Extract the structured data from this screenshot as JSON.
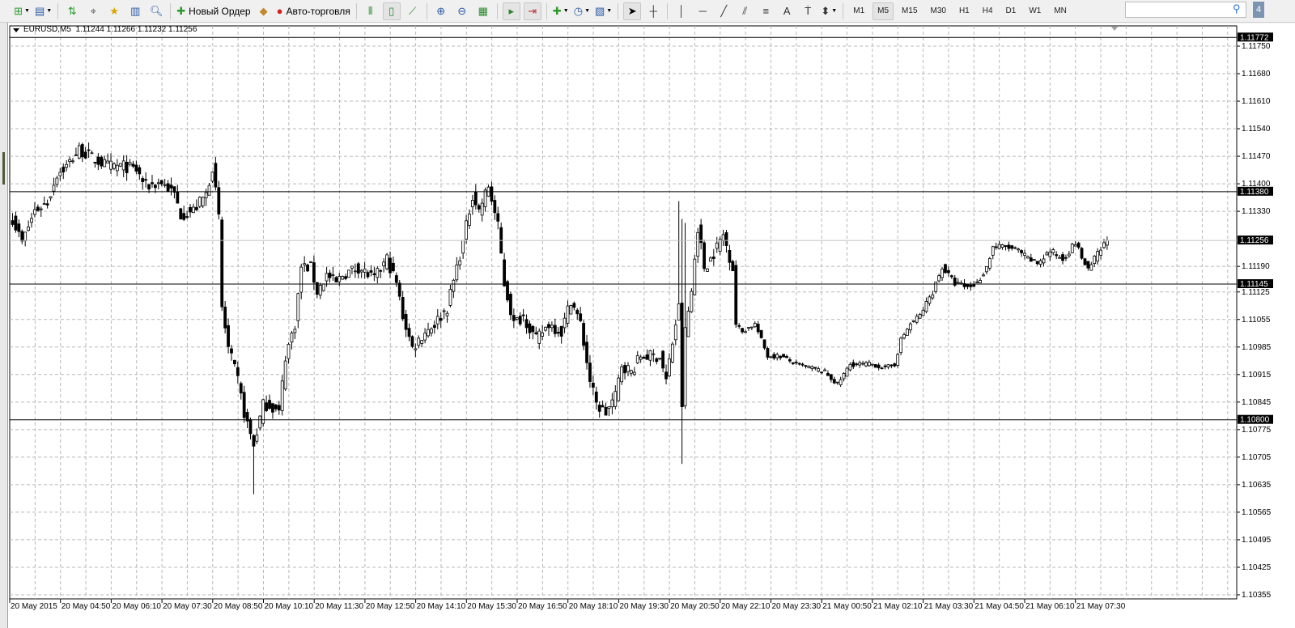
{
  "toolbar": {
    "new_order": "Новый Ордер",
    "auto_trading": "Авто-торговля",
    "timeframes": [
      "M1",
      "M5",
      "M15",
      "M30",
      "H1",
      "H4",
      "D1",
      "W1",
      "MN"
    ],
    "active_timeframe": "M5",
    "search_placeholder": "",
    "badge": "4",
    "icons": [
      "new-chart-icon",
      "profiles-icon",
      "market-watch-icon",
      "navigator-icon",
      "data-window-icon",
      "terminal-icon",
      "strategy-tester-icon",
      "new-order-icon",
      "metaeditor-icon",
      "auto-trading-icon",
      "bar-chart-icon",
      "candlesticks-icon",
      "line-chart-icon",
      "zoom-in-icon",
      "zoom-out-icon",
      "tile-windows-icon",
      "chart-shift-icon",
      "autoscroll-icon",
      "indicators-icon",
      "periods-icon",
      "templates-icon",
      "cursor-icon",
      "crosshair-icon",
      "vertical-line-icon",
      "horizontal-line-icon",
      "trendline-icon",
      "fibonacci-icon",
      "channel-icon",
      "text-icon",
      "text-label-icon",
      "arrows-icon"
    ]
  },
  "chart": {
    "symbol_info": "EURUSD,M5  1.11244 1.11266 1.11232 1.11256",
    "price_labels": [
      "1.11750",
      "1.11680",
      "1.11610",
      "1.11540",
      "1.11470",
      "1.11400",
      "1.11330",
      "1.11190",
      "1.11125",
      "1.11055",
      "1.10985",
      "1.10915",
      "1.10845",
      "1.10775",
      "1.10705",
      "1.10635",
      "1.10565",
      "1.10495",
      "1.10425",
      "1.10355"
    ],
    "time_labels": [
      "20 May 2015",
      "20 May 04:50",
      "20 May 06:10",
      "20 May 07:30",
      "20 May 08:50",
      "20 May 10:10",
      "20 May 11:30",
      "20 May 12:50",
      "20 May 14:10",
      "20 May 15:30",
      "20 May 16:50",
      "20 May 18:10",
      "20 May 19:30",
      "20 May 20:50",
      "20 May 22:10",
      "20 May 23:30",
      "21 May 00:50",
      "21 May 02:10",
      "21 May 03:30",
      "21 May 04:50",
      "21 May 06:10",
      "21 May 07:30"
    ],
    "hlines": [
      "1.11772",
      "1.11380",
      "1.11145",
      "1.10800"
    ],
    "bid": "1.11256"
  },
  "chart_data": {
    "type": "candlestick",
    "symbol": "EURUSD",
    "timeframe": "M5",
    "ylim": [
      1.10345,
      1.11779
    ],
    "bars_per_time_label": 16,
    "close_waypoints": [
      [
        0,
        1.11312
      ],
      [
        3,
        1.1125
      ],
      [
        7,
        1.11332
      ],
      [
        11,
        1.11353
      ],
      [
        14,
        1.11425
      ],
      [
        17,
        1.11445
      ],
      [
        21,
        1.11487
      ],
      [
        25,
        1.11466
      ],
      [
        30,
        1.11445
      ],
      [
        35,
        1.11445
      ],
      [
        39,
        1.11435
      ],
      [
        42,
        1.11394
      ],
      [
        47,
        1.11404
      ],
      [
        51,
        1.11373
      ],
      [
        53,
        1.11322
      ],
      [
        57,
        1.11332
      ],
      [
        61,
        1.11373
      ],
      [
        63,
        1.11445
      ],
      [
        65,
        1.11312
      ],
      [
        66,
        1.11085
      ],
      [
        68,
        1.10982
      ],
      [
        71,
        1.109
      ],
      [
        73,
        1.10818
      ],
      [
        76,
        1.10735
      ],
      [
        79,
        1.10838
      ],
      [
        81,
        1.10838
      ],
      [
        84,
        1.10818
      ],
      [
        86,
        1.10962
      ],
      [
        89,
        1.11044
      ],
      [
        91,
        1.11188
      ],
      [
        94,
        1.11188
      ],
      [
        96,
        1.11126
      ],
      [
        99,
        1.11168
      ],
      [
        102,
        1.11147
      ],
      [
        104,
        1.11168
      ],
      [
        109,
        1.11188
      ],
      [
        114,
        1.11157
      ],
      [
        118,
        1.11209
      ],
      [
        121,
        1.11147
      ],
      [
        123,
        1.11065
      ],
      [
        126,
        1.10982
      ],
      [
        130,
        1.11024
      ],
      [
        133,
        1.11044
      ],
      [
        137,
        1.11085
      ],
      [
        140,
        1.11188
      ],
      [
        142,
        1.1125
      ],
      [
        145,
        1.11373
      ],
      [
        147,
        1.11332
      ],
      [
        150,
        1.11394
      ],
      [
        153,
        1.11291
      ],
      [
        155,
        1.11147
      ],
      [
        158,
        1.11044
      ],
      [
        161,
        1.11065
      ],
      [
        165,
        1.11003
      ],
      [
        169,
        1.11044
      ],
      [
        173,
        1.11024
      ],
      [
        176,
        1.11106
      ],
      [
        179,
        1.11044
      ],
      [
        182,
        1.109
      ],
      [
        184,
        1.10838
      ],
      [
        187,
        1.10818
      ],
      [
        190,
        1.10859
      ],
      [
        192,
        1.10941
      ],
      [
        195,
        1.10921
      ],
      [
        198,
        1.10962
      ],
      [
        204,
        1.10962
      ],
      [
        206,
        1.109
      ],
      [
        209,
        1.11044
      ],
      [
        210,
        1.11085
      ],
      [
        211,
        1.10838
      ],
      [
        212,
        1.11024
      ],
      [
        214,
        1.11126
      ],
      [
        216,
        1.11291
      ],
      [
        218,
        1.11188
      ],
      [
        220,
        1.11209
      ],
      [
        224,
        1.1127
      ],
      [
        227,
        1.11188
      ],
      [
        228,
        1.11044
      ],
      [
        230,
        1.11024
      ],
      [
        234,
        1.11044
      ],
      [
        238,
        1.10962
      ],
      [
        242,
        1.10962
      ],
      [
        247,
        1.10941
      ],
      [
        252,
        1.10931
      ],
      [
        256,
        1.10921
      ],
      [
        260,
        1.1089
      ],
      [
        264,
        1.10941
      ],
      [
        267,
        1.10941
      ],
      [
        271,
        1.10941
      ],
      [
        275,
        1.10931
      ],
      [
        278,
        1.10941
      ],
      [
        280,
        1.11003
      ],
      [
        283,
        1.11044
      ],
      [
        286,
        1.11065
      ],
      [
        290,
        1.11126
      ],
      [
        293,
        1.11188
      ],
      [
        297,
        1.11147
      ],
      [
        301,
        1.11137
      ],
      [
        304,
        1.11147
      ],
      [
        307,
        1.11188
      ],
      [
        309,
        1.1124
      ],
      [
        313,
        1.1124
      ],
      [
        317,
        1.11229
      ],
      [
        320,
        1.11209
      ],
      [
        323,
        1.11198
      ],
      [
        327,
        1.11229
      ],
      [
        331,
        1.11209
      ],
      [
        335,
        1.1125
      ],
      [
        339,
        1.11178
      ],
      [
        341,
        1.11209
      ],
      [
        345,
        1.11256
      ]
    ]
  }
}
